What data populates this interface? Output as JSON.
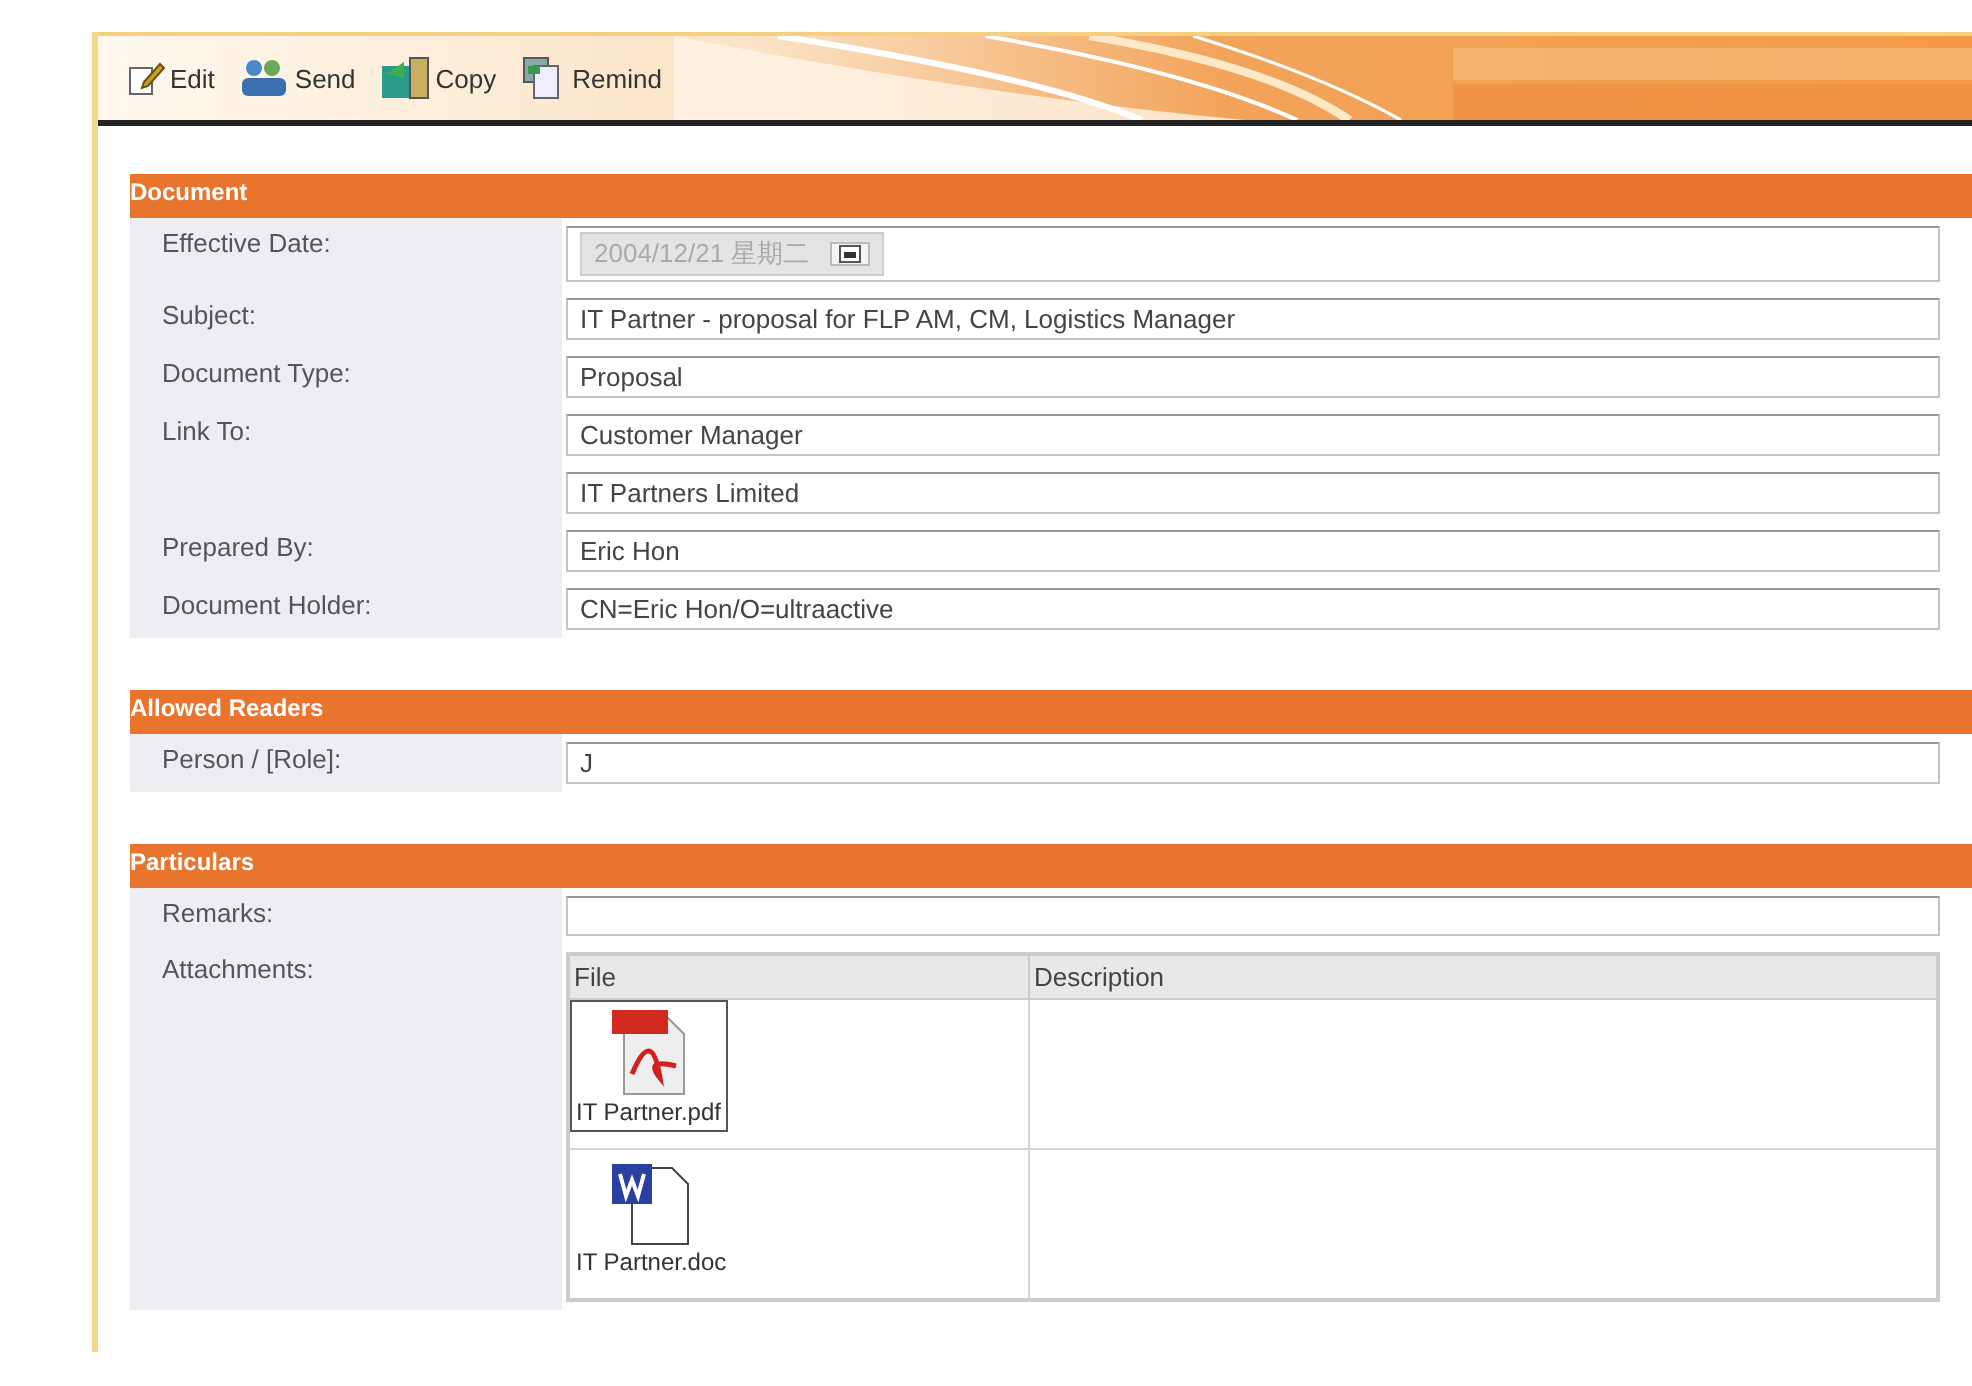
{
  "toolbar": [
    {
      "label": "Edit",
      "kind": "edit"
    },
    {
      "label": "Send",
      "kind": "send"
    },
    {
      "label": "Copy",
      "kind": "copy"
    },
    {
      "label": "Remind",
      "kind": "remind"
    }
  ],
  "sections": [
    {
      "title": "Document",
      "fields": [
        {
          "label": "Effective Date:",
          "value": "2004/12/21 星期二",
          "kind": "date",
          "disabled": true
        },
        {
          "label": "Subject:",
          "value": "IT Partner - proposal for FLP AM, CM, Logistics Manager",
          "kind": "text"
        },
        {
          "label": "Document Type:",
          "value": "Proposal",
          "kind": "text"
        },
        {
          "label": "Link To:",
          "value": "Customer Manager",
          "kind": "text"
        },
        {
          "value": "IT Partners Limited",
          "kind": "text"
        },
        {
          "label": "Prepared By:",
          "value": "Eric Hon",
          "kind": "text"
        },
        {
          "label": "Document Holder:",
          "value": "CN=Eric Hon/O=ultraactive",
          "kind": "text"
        }
      ]
    },
    {
      "title": "Allowed Readers",
      "fields": [
        {
          "label": "Person / [Role]:",
          "value": "J",
          "kind": "text"
        }
      ]
    },
    {
      "title": "Particulars",
      "fields": [
        {
          "label": "Remarks:",
          "kind": "text"
        },
        {
          "label": "Attachments:",
          "kind": "attachments",
          "columns": [
            "File",
            "Description"
          ],
          "files": [
            {
              "name": "IT Partner.pdf",
              "kind": "pdf",
              "selected": true
            },
            {
              "name": "IT Partner.doc",
              "kind": "doc",
              "selected": false
            }
          ]
        }
      ]
    }
  ]
}
